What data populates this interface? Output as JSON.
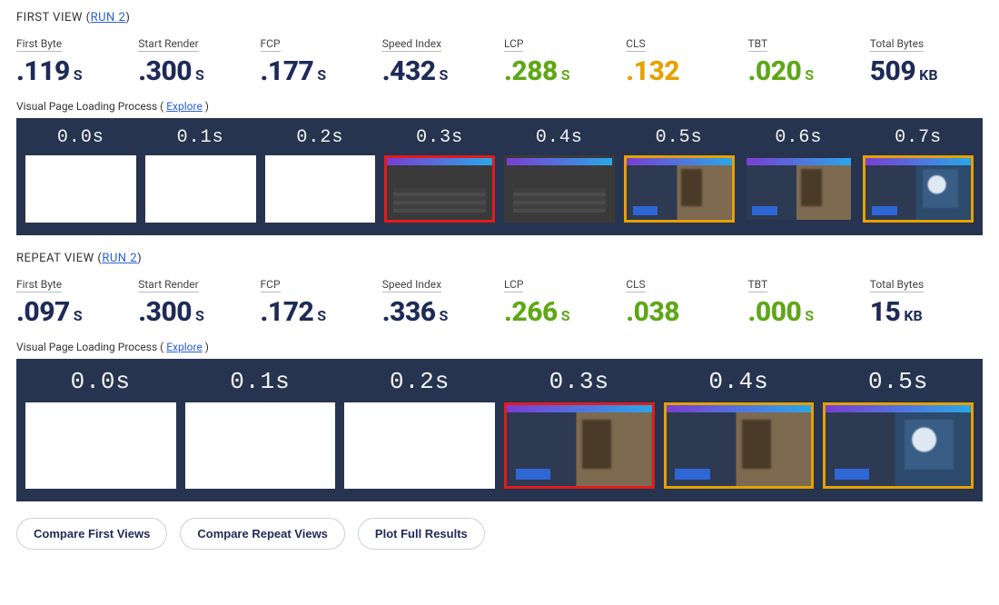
{
  "views": [
    {
      "title_prefix": "FIRST VIEW",
      "run_label": "RUN 2",
      "metrics": [
        {
          "label": "First Byte",
          "value": ".119",
          "unit": "S",
          "color": "default"
        },
        {
          "label": "Start Render",
          "value": ".300",
          "unit": "S",
          "color": "default"
        },
        {
          "label": "FCP",
          "value": ".177",
          "unit": "S",
          "color": "default"
        },
        {
          "label": "Speed Index",
          "value": ".432",
          "unit": "S",
          "color": "default"
        },
        {
          "label": "LCP",
          "value": ".288",
          "unit": "S",
          "color": "green"
        },
        {
          "label": "CLS",
          "value": ".132",
          "unit": "",
          "color": "orange"
        },
        {
          "label": "TBT",
          "value": ".020",
          "unit": "S",
          "color": "green"
        },
        {
          "label": "Total Bytes",
          "value": "509",
          "unit": "KB",
          "color": "default"
        }
      ],
      "vplp_label": "Visual Page Loading Process",
      "explore_label": "Explore",
      "frames": [
        {
          "time": "0.0s",
          "kind": "blank",
          "highlight": ""
        },
        {
          "time": "0.1s",
          "kind": "blank",
          "highlight": ""
        },
        {
          "time": "0.2s",
          "kind": "blank",
          "highlight": ""
        },
        {
          "time": "0.3s",
          "kind": "dark",
          "highlight": "red"
        },
        {
          "time": "0.4s",
          "kind": "dark",
          "highlight": ""
        },
        {
          "time": "0.5s",
          "kind": "loaded",
          "highlight": "orange"
        },
        {
          "time": "0.6s",
          "kind": "loaded",
          "highlight": ""
        },
        {
          "time": "0.7s",
          "kind": "final",
          "highlight": "orange"
        }
      ]
    },
    {
      "title_prefix": "REPEAT VIEW",
      "run_label": "RUN 2",
      "metrics": [
        {
          "label": "First Byte",
          "value": ".097",
          "unit": "S",
          "color": "default"
        },
        {
          "label": "Start Render",
          "value": ".300",
          "unit": "S",
          "color": "default"
        },
        {
          "label": "FCP",
          "value": ".172",
          "unit": "S",
          "color": "default"
        },
        {
          "label": "Speed Index",
          "value": ".336",
          "unit": "S",
          "color": "default"
        },
        {
          "label": "LCP",
          "value": ".266",
          "unit": "S",
          "color": "green"
        },
        {
          "label": "CLS",
          "value": ".038",
          "unit": "",
          "color": "green"
        },
        {
          "label": "TBT",
          "value": ".000",
          "unit": "S",
          "color": "green"
        },
        {
          "label": "Total Bytes",
          "value": "15",
          "unit": "KB",
          "color": "default"
        }
      ],
      "vplp_label": "Visual Page Loading Process",
      "explore_label": "Explore",
      "frames": [
        {
          "time": "0.0s",
          "kind": "blank",
          "highlight": ""
        },
        {
          "time": "0.1s",
          "kind": "blank",
          "highlight": ""
        },
        {
          "time": "0.2s",
          "kind": "blank",
          "highlight": ""
        },
        {
          "time": "0.3s",
          "kind": "loaded",
          "highlight": "red"
        },
        {
          "time": "0.4s",
          "kind": "loaded",
          "highlight": "orange"
        },
        {
          "time": "0.5s",
          "kind": "final",
          "highlight": "orange"
        }
      ]
    }
  ],
  "buttons": {
    "compare_first": "Compare First Views",
    "compare_repeat": "Compare Repeat Views",
    "plot_full": "Plot Full Results"
  }
}
